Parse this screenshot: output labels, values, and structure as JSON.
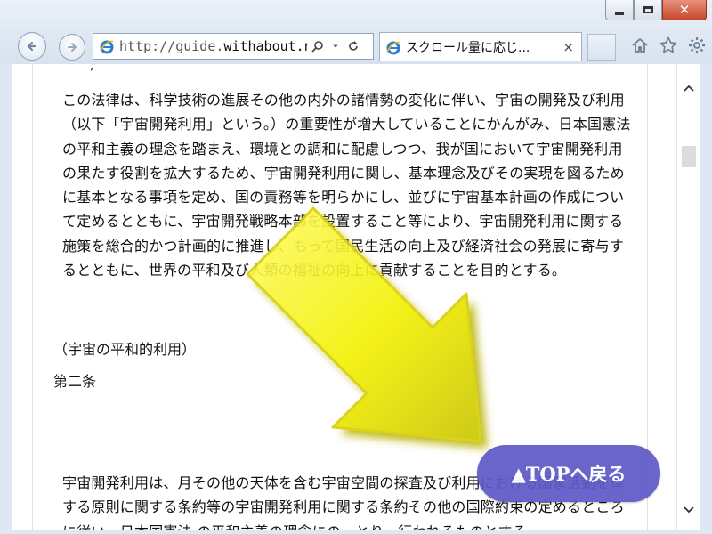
{
  "browser": {
    "address_url_prefix": "http://guide.",
    "address_url_domain": "withabout.net",
    "tab_title": "スクロール量に応じ...",
    "icons": [
      "back-arrow-icon",
      "forward-arrow-icon",
      "ie-logo-icon",
      "search-icon",
      "dropdown-arrow-icon",
      "refresh-icon",
      "tab-close-icon",
      "home-icon",
      "favorites-star-icon",
      "settings-gear-icon",
      "minimize-icon",
      "maximize-icon",
      "close-icon"
    ]
  },
  "content": {
    "top_fragment": "',",
    "paragraph_1": "この法律は、科学技術の進展その他の内外の諸情勢の変化に伴い、宇宙の開発及び利用（以下「宇宙開発利用」という。）の重要性が増大していることにかんがみ、日本国憲法 の平和主義の理念を踏まえ、環境との調和に配慮しつつ、我が国において宇宙開発利用の果たす役割を拡大するため、宇宙開発利用に関し、基本理念及びその実現を図るために基本となる事項を定め、国の責務等を明らかにし、並びに宇宙基本計画の作成について定めるとともに、宇宙開発戦略本部を設置すること等により、宇宙開発利用に関する施策を総合的かつ計画的に推進し、もって国民生活の向上及び経済社会の発展に寄与するとともに、世界の平和及び人類の福祉の向上に貢献することを目的とする。",
    "heading_note": "（宇宙の平和的利用）",
    "heading_article": "第二条",
    "paragraph_2": "宇宙開発利用は、月その他の天体を含む宇宙空間の探査及び利用における国家活動を律する原則に関する条約等の宇宙開発利用に関する条約その他の国際約束の定めるところに従い、日本国憲法 の平和主義の理念にのっとり、行われるものとする。"
  },
  "overlay": {
    "top_button_label": "▲TOPへ戻る",
    "arrow_color": "#f3f000"
  }
}
